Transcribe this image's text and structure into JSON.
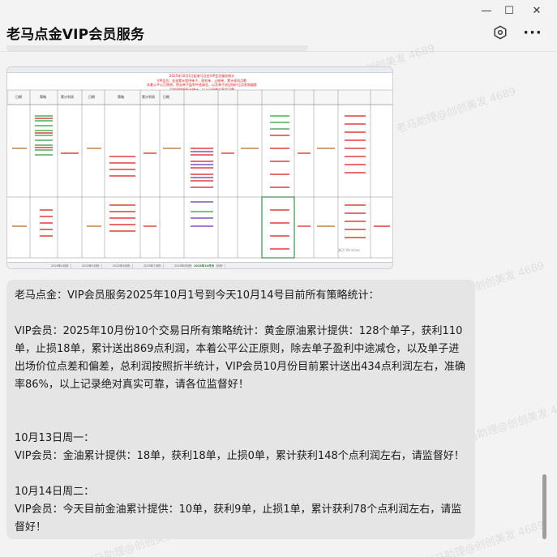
{
  "window": {
    "title": "老马点金VIP会员服务",
    "controls": {
      "minimize": "—",
      "maximize": "☐",
      "close": "✕"
    }
  },
  "header": {
    "hex_icon": "hexagon-icon",
    "more_label": "···"
  },
  "watermarks": [
    "老马助理@创创美发 4689",
    "老马助理@创创美发 4689",
    "老马助理@创创美发 4689",
    "老马助理@创创美发 4689",
    "老马助理@创创美发 4689",
    "老马助理@创创美发 4689"
  ],
  "sheet": {
    "banner_lines": [
      "2025年10月1日起老马点金VIP会员服务统计",
      "VIP会员：金油累计提供单子，获利单，止损单，累计获利点数",
      "本着公平公正原则，除去单子盈利中途减仓，以及单子进出场价位点差和偏差",
      "总利润按照折半统计，以上记录绝对真实可靠"
    ],
    "col_headers": [
      "日期",
      "策略",
      "累计利润",
      "日期",
      "策略",
      "累计利润",
      "日期"
    ],
    "tabs": [
      "2025年4月份",
      "2025年5月份",
      "2025年6月份",
      "2025年7月份",
      "2025年8月份",
      "2025年9月份",
      "2025年10月份"
    ],
    "active_tab": "2025年10月份",
    "activate": "激活 Windows"
  },
  "message": {
    "title": "老马点金：VIP会员服务2025年10月1号到今天10月14号目前所有策略统计：",
    "summary": "VIP会员：2025年10月份10个交易日所有策略统计：黄金原油累计提供：128个单子，获利110单，止损18单，累计送出869点利润，本着公平公正原则，除去单子盈利中途减仓，以及单子进出场价位点差和偏差，总利润按照折半统计，VIP会员10月份目前累计送出434点利润左右，准确率86%，以上记录绝对真实可靠，请各位监督好！",
    "day1_date": "10月13日周一：",
    "day1_text": "VIP会员：金油累计提供：18单，获利18单，止损0单，累计获利148个点利润左右，请监督好！",
    "day2_date": "10月14日周二：",
    "day2_text": "VIP会员：今天目前金油累计提供：10单，获利9单，止损1单，累计获利78个点利润左右，请监督好！"
  }
}
